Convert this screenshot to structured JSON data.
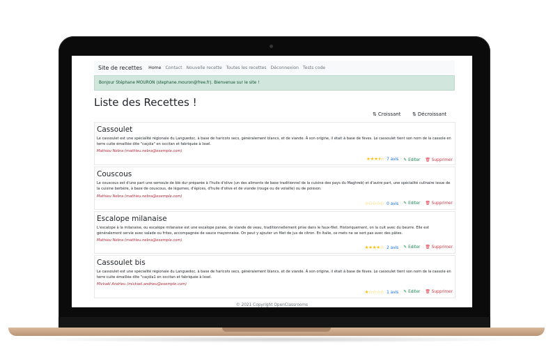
{
  "navbar": {
    "brand": "Site de recettes",
    "links": [
      "Home",
      "Contact",
      "Nouvelle recette",
      "Toutes les recettes",
      "Déconnexion",
      "Tests code"
    ]
  },
  "alert": {
    "text": "Bonjour Stéphane MOURON (stephane.mouron@free.fr). Bienvenue sur le site !"
  },
  "page": {
    "title": "Liste des Recettes !",
    "sort_asc": "Croissant",
    "sort_desc": "Décroissant"
  },
  "recipes": [
    {
      "title": "Cassoulet",
      "text": "Le cassoulet est une spécialité régionale du Languedoc, à base de haricots secs, généralement blancs, et de viande. À son origine, il était à base de fèves. Le cassoulet tient son nom de la cassole en terre cuite émaillée dite \"caçòla\" en occitan et fabriquée à Issel.",
      "author": "Mathieu Nebra (mathieu.nebra@exemple.com)",
      "rating": 3.5,
      "stars": "★★★⯨☆",
      "avis": "7 avis"
    },
    {
      "title": "Couscous",
      "text": "Le couscous est d'une part une semoule de blé dur préparée à l'huile d'olive (un des aliments de base traditionnel de la cuisine des pays du Maghreb) et d'autre part, une spécialité culinaire issue de la cuisine berbère, à base de couscous, de légumes, d'épices, d'huile d'olive et de viande (rouge ou de volaille) ou de poisson.",
      "author": "Mathieu Nebra (mathieu.nebra@exemple.com)",
      "rating": 0,
      "stars": "☆☆☆☆☆",
      "avis": "0 avis"
    },
    {
      "title": "Escalope milanaise",
      "text": "L'escalope à la milanaise, ou escalope milanaise est une escalope panée, de viande de veau, traditionnellement prise dans le faux-filet. Historiquement, on la cuit avec du beurre. Elle est généralement servie avec salade ou frites, accompagnée de sauce mayonnaise. On peut y ajouter un filet de jus de citron. En Italie, ce mets ne se sert pas avec des pâtes.",
      "author": "Mathieu Nebra (mathieu.nebra@exemple.com)",
      "rating": 4,
      "stars": "★★★★☆",
      "avis": "2 avis"
    },
    {
      "title": "Cassoulet bis",
      "text": "Le cassoulet est une spécialité régionale du Languedoc, à base de haricots secs, généralement blancs, et de viande. À son origine, il était à base de fèves. Le cassoulet tient son nom de la cassole en terre cuite émaillée dite \"caçòla1 en occitan et fabriquée à Issel.",
      "author": "Mickaël Andrieu (mickael.andrieu@exemple.com)",
      "rating": 1,
      "stars": "★☆☆☆☆",
      "avis": "1 avis"
    }
  ],
  "actions": {
    "edit": "Editer",
    "delete": "Supprimer"
  },
  "footer": {
    "text": "© 2021 Copyright OpenClassrooms"
  },
  "colors": {
    "alert_bg": "#d1e7dd",
    "star": "#ffc107",
    "author": "#b02a37",
    "edit": "#198754",
    "delete": "#dc3545",
    "link": "#0d6efd"
  }
}
